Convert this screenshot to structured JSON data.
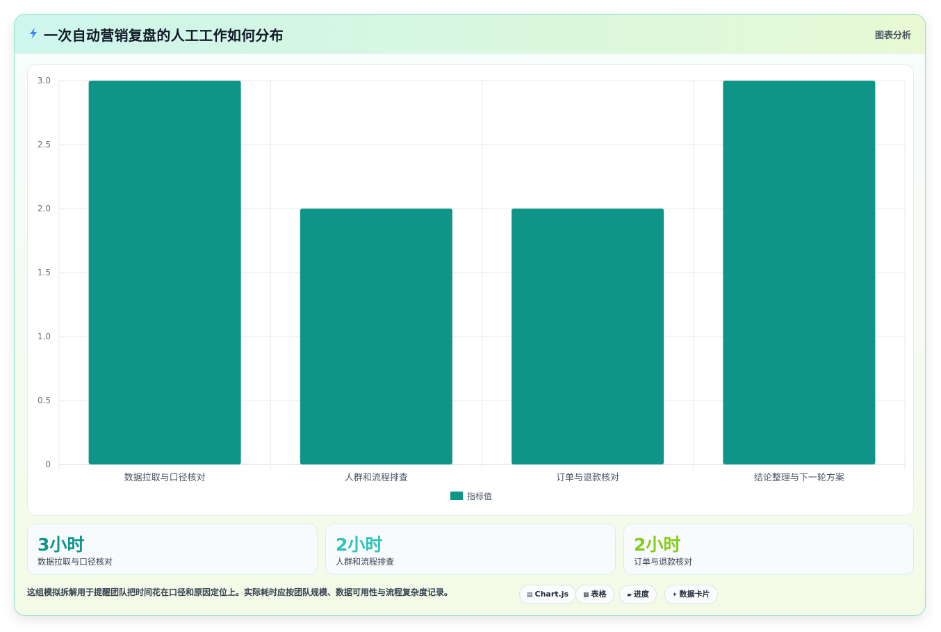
{
  "header": {
    "title": "一次自动营销复盘的人工工作如何分布",
    "tag": "图表分析",
    "icon": "lightning-icon"
  },
  "chart_data": {
    "type": "bar",
    "categories": [
      "数据拉取与口径核对",
      "人群和流程排查",
      "订单与退款核对",
      "结论整理与下一轮方案"
    ],
    "series": [
      {
        "name": "指标值",
        "values": [
          3,
          2,
          2,
          3
        ],
        "color": "#0f9488"
      }
    ],
    "ylim": [
      0,
      3
    ],
    "yticks": [
      "0",
      "0.5",
      "1.0",
      "1.5",
      "2.0",
      "2.5",
      "3.0"
    ],
    "grid": true,
    "legend_position": "bottom"
  },
  "stats": [
    {
      "value": "3小时",
      "label": "数据拉取与口径核对",
      "color": "#0f9488"
    },
    {
      "value": "2小时",
      "label": "人群和流程排查",
      "color": "#2ec4b6"
    },
    {
      "value": "2小时",
      "label": "订单与退款核对",
      "color": "#84cc16"
    }
  ],
  "footnote": "这组模拟拆解用于提醒团队把时间花在口径和原因定位上。实际耗时应按团队规模、数据可用性与流程复杂度记录。",
  "chips": [
    {
      "icon": "chart-icon",
      "glyph": "▤",
      "label": "Chart.js"
    },
    {
      "icon": "table-icon",
      "glyph": "▦",
      "label": "表格"
    },
    {
      "icon": "progress-icon",
      "glyph": "▰",
      "label": "进度"
    },
    {
      "icon": "sparkle-icon",
      "glyph": "✦",
      "label": "数据卡片"
    }
  ]
}
